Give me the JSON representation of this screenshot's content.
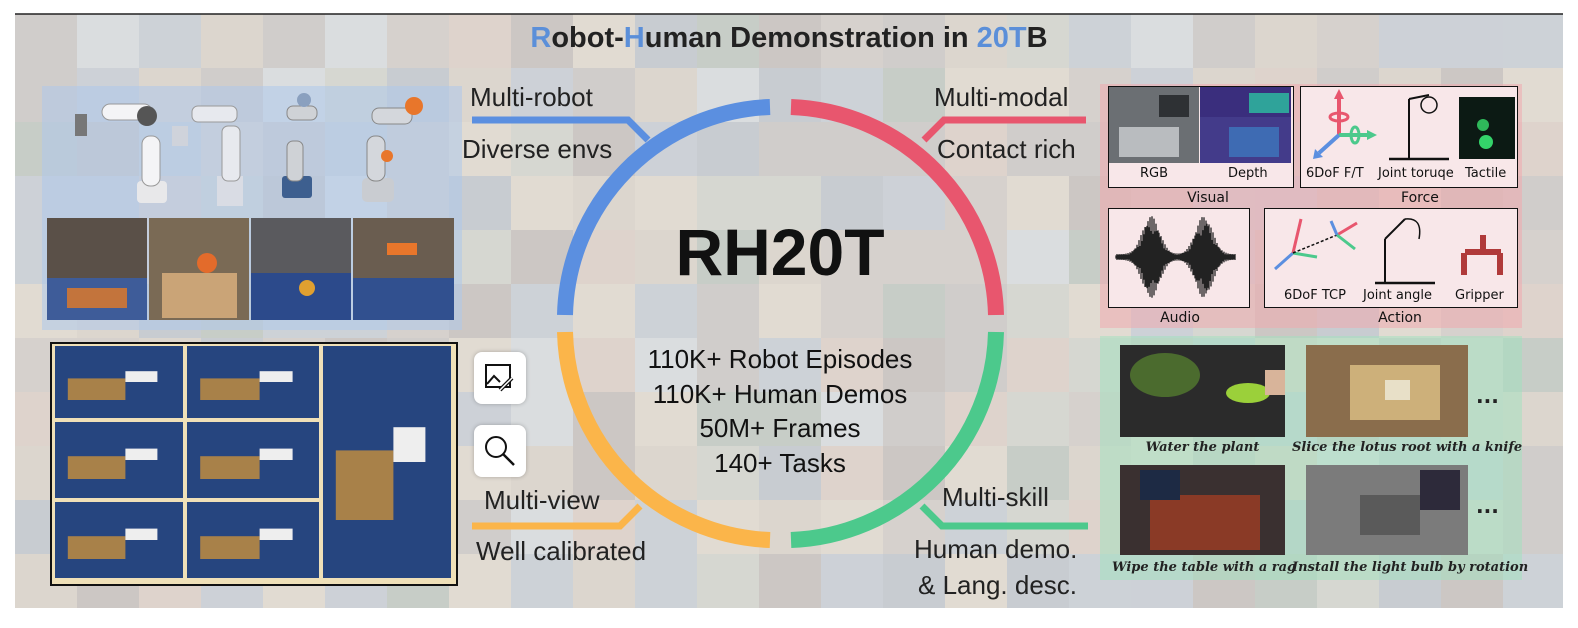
{
  "title": {
    "parts": [
      {
        "text": "R",
        "accent": true
      },
      {
        "text": "obot-",
        "accent": false
      },
      {
        "text": "H",
        "accent": true
      },
      {
        "text": "uman Demonstration in ",
        "accent": false
      },
      {
        "text": "20T",
        "accent": true
      },
      {
        "text": "B",
        "accent": false
      }
    ]
  },
  "colors": {
    "accent": "#5b8fd9",
    "blue": "#5b8fe0",
    "red": "#e8566e",
    "green": "#4cc98c",
    "orange": "#fbb54a",
    "gripper": "#b03a3a"
  },
  "center": {
    "name": "RH20T",
    "stats": [
      "110K+ Robot Episodes",
      "110K+ Human Demos",
      "50M+ Frames",
      "140+ Tasks"
    ]
  },
  "features": {
    "top_left": [
      "Multi-robot",
      "Diverse envs"
    ],
    "top_right": [
      "Multi-modal",
      "Contact rich"
    ],
    "bottom_left": [
      "Multi-view",
      "Well calibrated"
    ],
    "bottom_right": [
      "Multi-skill",
      "Human demo.",
      "& Lang. desc."
    ]
  },
  "modal": {
    "visual": {
      "title": "Visual",
      "rgb": "RGB",
      "depth": "Depth"
    },
    "force": {
      "title": "Force",
      "ft": "6DoF F/T",
      "torque": "Joint toruqe",
      "tactile": "Tactile"
    },
    "audio": {
      "title": "Audio"
    },
    "action": {
      "title": "Action",
      "tcp": "6DoF TCP",
      "angle": "Joint angle",
      "gripper": "Gripper"
    }
  },
  "skills": {
    "captions": [
      "Water the plant",
      "Slice the lotus root with a knife",
      "Wipe the table with a rag",
      "Install the light bulb by rotation"
    ],
    "ellipsis": "..."
  },
  "icons": [
    "image-edit-icon",
    "search-icon"
  ]
}
